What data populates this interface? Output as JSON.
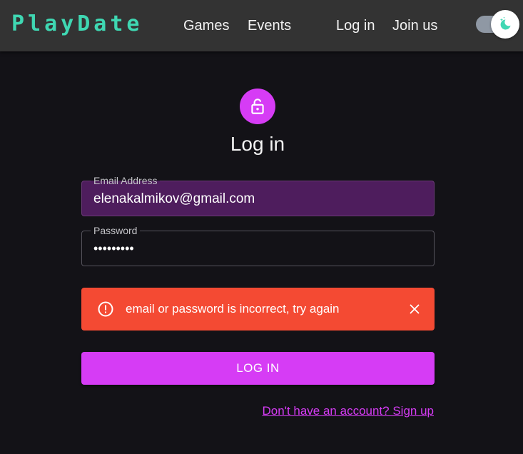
{
  "header": {
    "brand": "PlayDate",
    "nav": {
      "games": "Games",
      "events": "Events",
      "login": "Log in",
      "join": "Join us"
    },
    "theme_toggle_icon": "moon-stars-icon"
  },
  "main": {
    "avatar_icon": "lock-open-icon",
    "title": "Log in",
    "email": {
      "label": "Email Address",
      "value": "elenakalmikov@gmail.com"
    },
    "password": {
      "label": "Password",
      "value": "•••••••••"
    },
    "alert": {
      "icon": "error-outline-icon",
      "message": "email or password is incorrect, try again",
      "close_icon": "close-icon"
    },
    "submit_label": "LOG IN",
    "signup_link": "Don't have an account? Sign up"
  },
  "colors": {
    "background": "#131217",
    "header": "#333333",
    "brand": "#3fd7b2",
    "accent": "#d63cf5",
    "error": "#f44a33",
    "email_field_fill": "#4e1d5d"
  }
}
